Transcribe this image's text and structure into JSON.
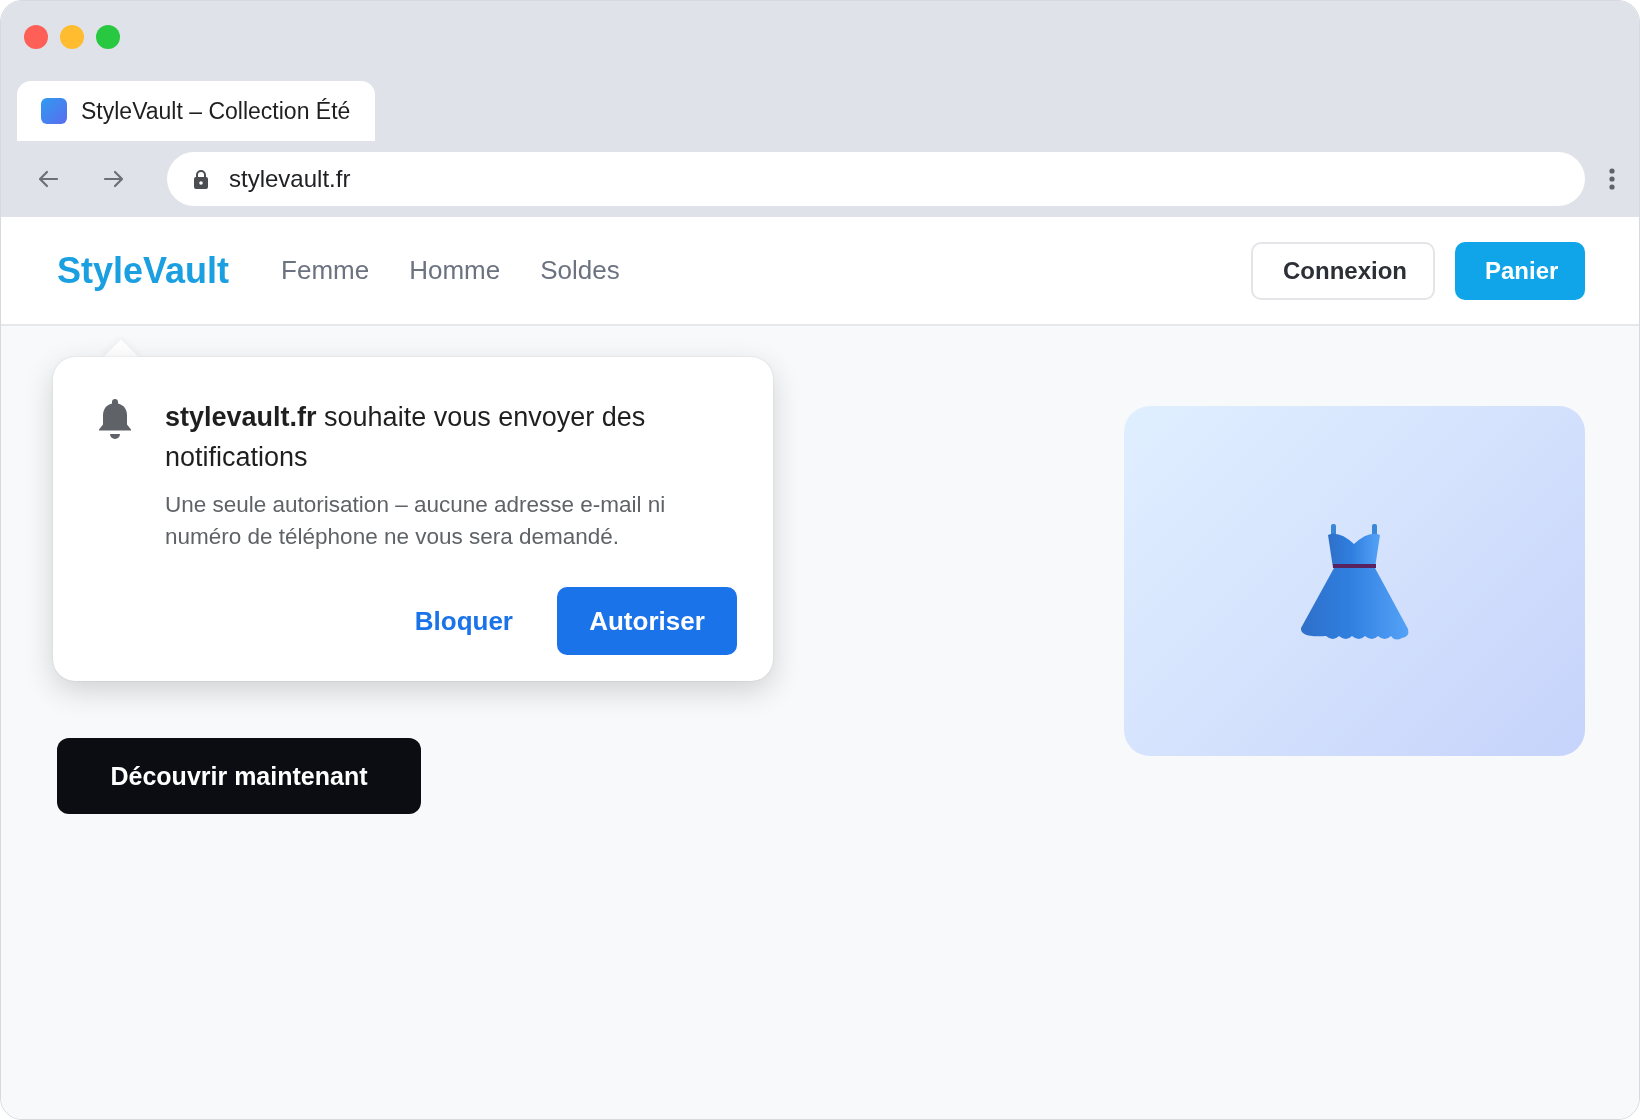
{
  "browser": {
    "tab": {
      "title": "StyleVault – Collection Été",
      "selected": true
    },
    "address": "stylevault.fr"
  },
  "site": {
    "logo": "StyleVault",
    "nav": [
      {
        "label": "Femme"
      },
      {
        "label": "Homme"
      },
      {
        "label": "Soldes"
      }
    ],
    "actions": [
      {
        "label": "Connexion",
        "kind": "outline"
      },
      {
        "label": "Panier",
        "kind": "primary"
      }
    ]
  },
  "hero": {
    "cta": "Découvrir maintenant",
    "image": {
      "kind": "dress"
    }
  },
  "permission_popup": {
    "title": "**stylevault.fr** souhaite vous envoyer des notifications",
    "description": "Une seule autorisation – aucune adresse e-mail ni numéro de téléphone ne vous sera demandé.",
    "buttons": [
      {
        "label": "Bloquer",
        "kind": "text"
      },
      {
        "label": "Autoriser",
        "kind": "primary"
      }
    ]
  }
}
